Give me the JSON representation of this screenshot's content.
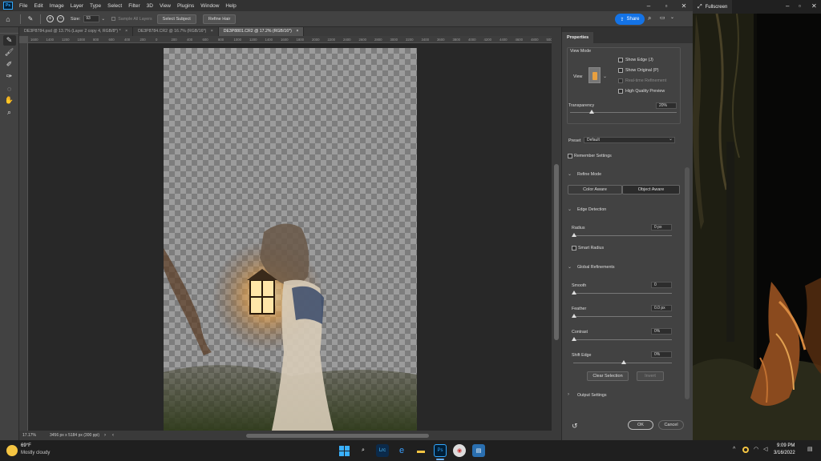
{
  "ps": {
    "logo": "Ps",
    "menu": [
      "File",
      "Edit",
      "Image",
      "Layer",
      "Type",
      "Select",
      "Filter",
      "3D",
      "View",
      "Plugins",
      "Window",
      "Help"
    ],
    "options": {
      "size_label": "Size:",
      "size_value": "93",
      "sample_all_layers": "Sample All Layers",
      "select_subject": "Select Subject",
      "refine_hair": "Refine Hair",
      "share": "Share"
    },
    "tabs": [
      {
        "label": "DE3P8784.psd @ 13.7% (Layer 2 copy 4, RGB/8*) *",
        "active": false
      },
      {
        "label": "DE3P8784.CR2 @ 16.7% (RGB/16*)",
        "active": false
      },
      {
        "label": "DE3P8801.CR2 @ 17.2% (RGB/16*)",
        "active": true
      }
    ],
    "ruler_ticks": [
      "1600",
      "1400",
      "1200",
      "1000",
      "800",
      "600",
      "400",
      "200",
      "0",
      "200",
      "400",
      "600",
      "800",
      "1000",
      "1200",
      "1400",
      "1600",
      "1800",
      "2000",
      "2200",
      "2400",
      "2600",
      "2800",
      "3000",
      "3200",
      "3400",
      "3600",
      "3800",
      "4000",
      "4200",
      "4400",
      "4600",
      "4800",
      "5000"
    ],
    "status": {
      "zoom": "17.17%",
      "doc_info": "3456 px x 5184 px (300 ppi)"
    }
  },
  "properties": {
    "tab": "Properties",
    "view_mode": {
      "label": "View Mode",
      "view_label": "View",
      "show_edge": "Show Edge (J)",
      "show_original": "Show Original (P)",
      "realtime": "Real-time Refinement",
      "high_quality": "High Quality Preview"
    },
    "transparency": {
      "label": "Transparency",
      "value": "20%",
      "fraction": 0.2
    },
    "preset": {
      "label": "Preset",
      "value": "Default"
    },
    "remember_settings": "Remember Settings",
    "refine_mode": {
      "label": "Refine Mode",
      "color_aware": "Color Aware",
      "object_aware": "Object Aware"
    },
    "edge_detection": {
      "label": "Edge Detection",
      "radius_label": "Radius",
      "radius_value": "0 px",
      "smart_radius": "Smart Radius"
    },
    "global": {
      "label": "Global Refinements",
      "smooth_label": "Smooth",
      "smooth_value": "0",
      "feather_label": "Feather",
      "feather_value": "0.0 px",
      "contrast_label": "Contrast",
      "contrast_value": "0%",
      "shift_label": "Shift Edge",
      "shift_value": "0%"
    },
    "clear_selection": "Clear Selection",
    "invert": "Invert",
    "output_settings": "Output Settings",
    "ok": "OK",
    "cancel": "Cancel"
  },
  "fullscreen": {
    "tab_label": "Fullscreen"
  },
  "taskbar": {
    "weather_temp": "69°F",
    "weather_desc": "Mostly cloudy",
    "time": "9:09 PM",
    "date": "3/16/2022"
  }
}
